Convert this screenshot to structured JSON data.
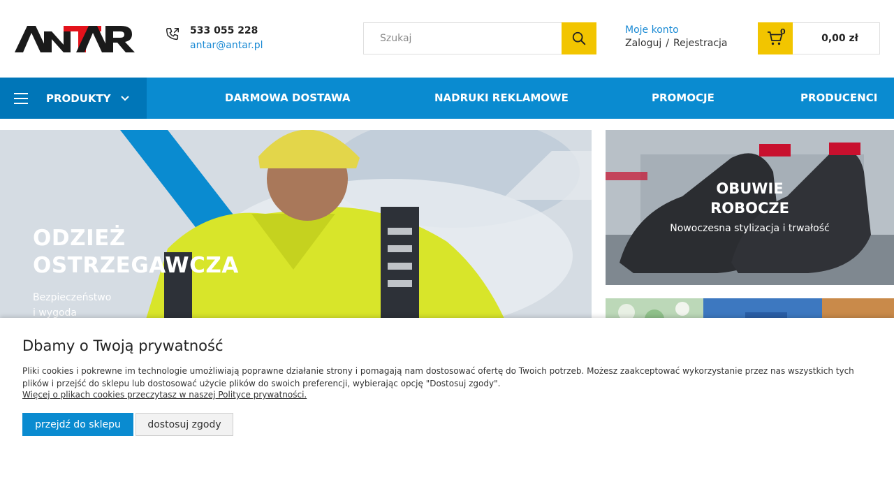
{
  "brand": {
    "logo_text": "ANTAR",
    "accent_color": "#0a8bd0",
    "highlight_color": "#f2c500",
    "logo_red": "#e3121b"
  },
  "header": {
    "phone": "533 055 228",
    "email": "antar@antar.pl",
    "search": {
      "placeholder": "Szukaj",
      "icon": "search-icon"
    },
    "account": {
      "title": "Moje konto",
      "login": "Zaloguj",
      "separator": "/",
      "register": "Rejestracja"
    },
    "cart": {
      "count": "0",
      "total": "0,00 zł",
      "icon": "cart-icon"
    }
  },
  "nav": {
    "products_label": "PRODUKTY",
    "links": [
      "DARMOWA DOSTAWA",
      "NADRUKI REKLAMOWE",
      "PROMOCJE",
      "PRODUCENCI"
    ]
  },
  "hero": {
    "main": {
      "title_line1": "ODZIEŻ",
      "title_line2": "OSTRZEGAWCZA",
      "subtitle_line1": "Bezpieczeństwo",
      "subtitle_line2": "i wygoda"
    },
    "side_top": {
      "title_line1": "OBUWIE",
      "title_line2": "ROBOCZE",
      "subtitle": "Nowoczesna stylizacja i trwałość"
    }
  },
  "cookie": {
    "title": "Dbamy o Twoją prywatność",
    "text": "Pliki cookies i pokrewne im technologie umożliwiają poprawne działanie strony i pomagają nam dostosować ofertę do Twoich potrzeb. Możesz zaakceptować wykorzystanie przez nas wszystkich tych plików i przejść do sklepu lub dostosować użycie plików do swoich preferencji, wybierając opcję \"Dostosuj zgody\".",
    "link": "Więcej o plikach cookies przeczytasz w naszej Polityce prywatności.",
    "accept_label": "przejdź do sklepu",
    "customize_label": "dostosuj zgody"
  }
}
